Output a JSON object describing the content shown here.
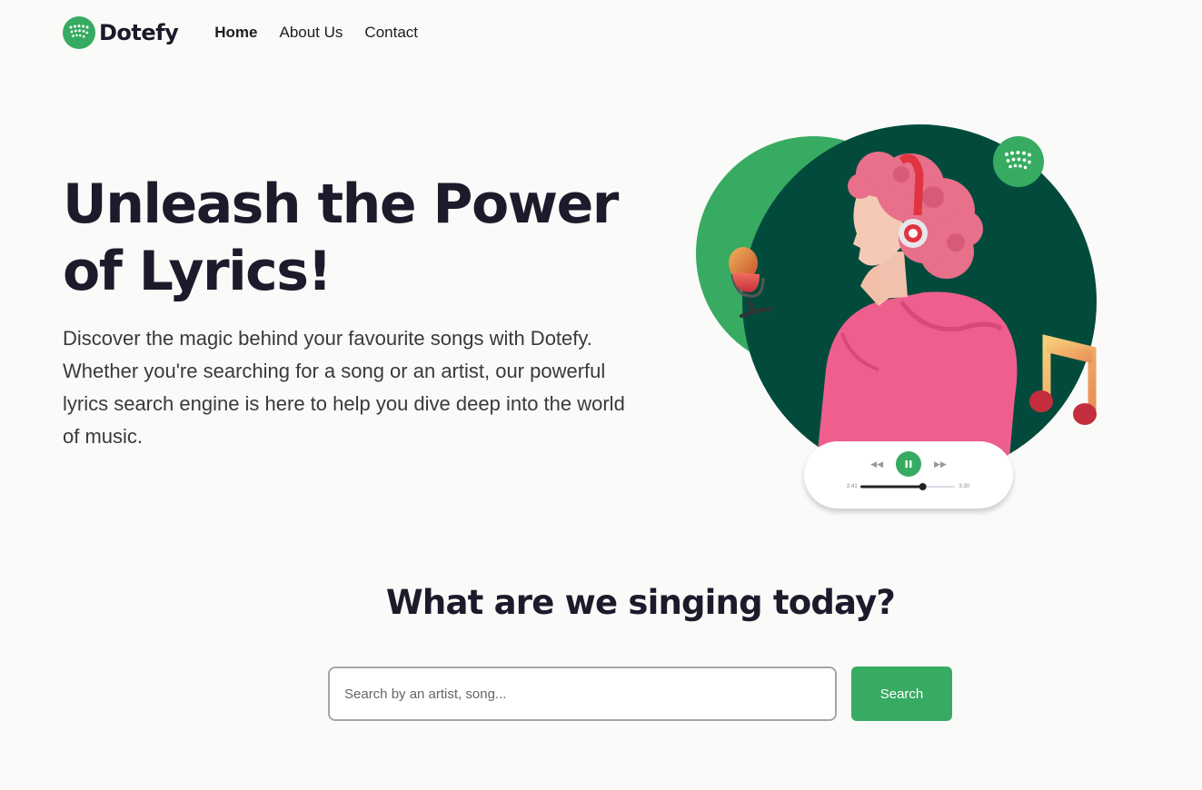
{
  "nav": {
    "brand": "Dotefy",
    "links": [
      {
        "label": "Home",
        "active": true
      },
      {
        "label": "About Us",
        "active": false
      },
      {
        "label": "Contact",
        "active": false
      }
    ]
  },
  "hero": {
    "title": "Unleash the Power of Lyrics!",
    "description": "Discover the magic behind your favourite songs with Dotefy. Whether you're searching for a song or an artist, our powerful lyrics search engine is here to help you dive deep into the world of music."
  },
  "player": {
    "elapsed": "2:41",
    "duration": "3:30",
    "progress": 0.66
  },
  "search": {
    "heading": "What are we singing today?",
    "placeholder": "Search by an artist, song...",
    "value": "",
    "button_label": "Search"
  },
  "colors": {
    "brand_green": "#37ab62",
    "dark_green": "#024b3c",
    "background": "#fafaf9",
    "heading_text": "#1c1b2b"
  },
  "icons": [
    "dotefy-logo-icon",
    "microphone-icon",
    "music-note-icon",
    "pause-icon",
    "rewind-icon",
    "fast-forward-icon"
  ]
}
